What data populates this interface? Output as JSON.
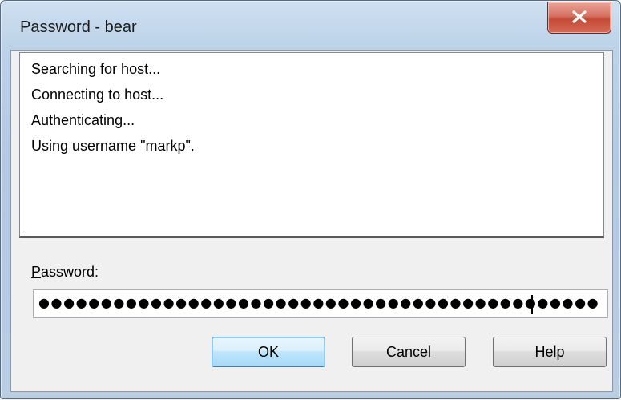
{
  "window": {
    "title": "Password - bear"
  },
  "log": {
    "lines": [
      "Searching for host...",
      "Connecting to host...",
      "Authenticating...",
      "Using username \"markp\"."
    ]
  },
  "password": {
    "label_mnemonic": "P",
    "label_rest": "assword:",
    "masked_value": "●●●●●●●●●●●●●●●●●●●●●●●●●●●●●●●●●●●●●●●●●●●●●"
  },
  "buttons": {
    "ok": "OK",
    "cancel": "Cancel",
    "help": "Help"
  },
  "icons": {
    "close": "close-icon"
  },
  "colors": {
    "close_button": "#c44a36",
    "default_button_border": "#3c7fb1",
    "window_frame": "#b9cde3"
  }
}
